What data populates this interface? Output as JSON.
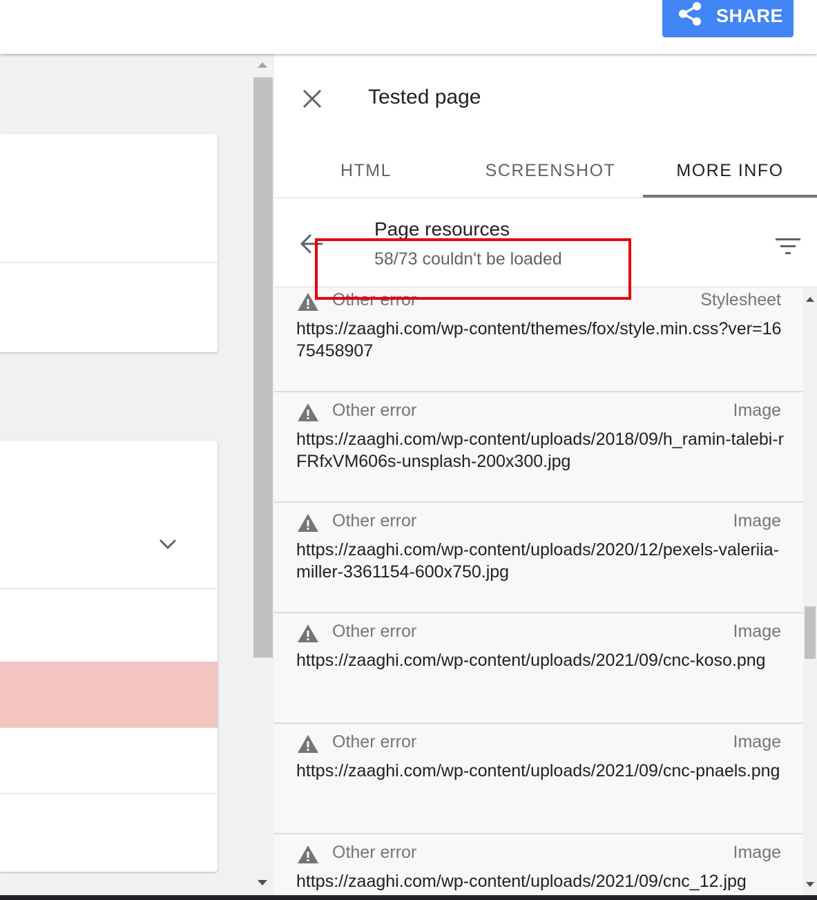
{
  "topbar": {
    "share_label": "SHARE",
    "share_color": "#4285f4"
  },
  "panel": {
    "title": "Tested page",
    "tabs": [
      {
        "label": "HTML",
        "active": false
      },
      {
        "label": "SCREENSHOT",
        "active": false
      },
      {
        "label": "MORE INFO",
        "active": true
      }
    ]
  },
  "resources": {
    "title": "Page resources",
    "subtitle": "58/73 couldn't be loaded",
    "items": [
      {
        "error": "Other error",
        "type": "Stylesheet",
        "url": "https://zaaghi.com/wp-content/themes/fox/style.min.css?ver=1675458907"
      },
      {
        "error": "Other error",
        "type": "Image",
        "url": "https://zaaghi.com/wp-content/uploads/2018/09/h_ramin-talebi-rFRfxVM606s-unsplash-200x300.jpg"
      },
      {
        "error": "Other error",
        "type": "Image",
        "url": "https://zaaghi.com/wp-content/uploads/2020/12/pexels-valeriia-miller-3361154-600x750.jpg"
      },
      {
        "error": "Other error",
        "type": "Image",
        "url": "https://zaaghi.com/wp-content/uploads/2021/09/cnc-koso.png"
      },
      {
        "error": "Other error",
        "type": "Image",
        "url": "https://zaaghi.com/wp-content/uploads/2021/09/cnc-pnaels.png"
      },
      {
        "error": "Other error",
        "type": "Image",
        "url": "https://zaaghi.com/wp-content/uploads/2021/09/cnc_12.jpg"
      }
    ]
  },
  "icons": {
    "share": "share-icon",
    "close": "close-icon",
    "back": "arrow-back-icon",
    "filter": "filter-icon",
    "warning": "warning-icon",
    "chevron": "chevron-down-icon"
  },
  "colors": {
    "highlight_box": "#e8000b",
    "error_row": "#f3c5c1"
  }
}
